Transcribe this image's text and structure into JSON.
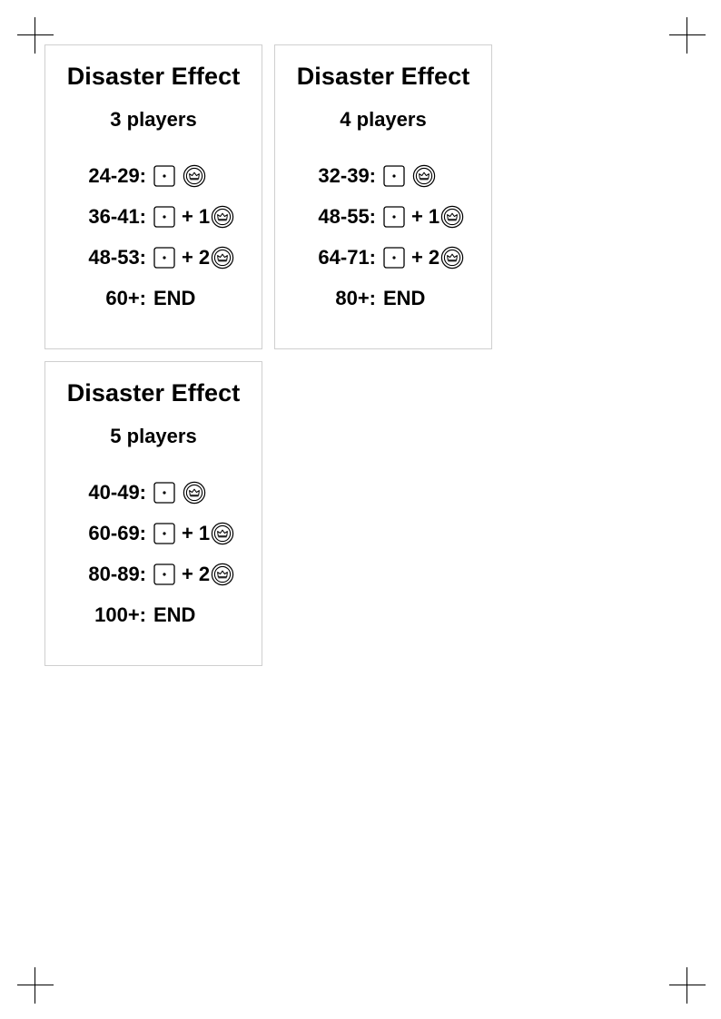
{
  "cards": [
    {
      "title": "Disaster Effect",
      "players": "3 players",
      "rows": [
        {
          "range": "24-29:",
          "plus": "",
          "count": ""
        },
        {
          "range": "36-41:",
          "plus": "+",
          "count": "1"
        },
        {
          "range": "48-53:",
          "plus": "+",
          "count": "2"
        }
      ],
      "end": {
        "range": "60+:",
        "text": "END"
      }
    },
    {
      "title": "Disaster Effect",
      "players": "4 players",
      "rows": [
        {
          "range": "32-39:",
          "plus": "",
          "count": ""
        },
        {
          "range": "48-55:",
          "plus": "+",
          "count": "1"
        },
        {
          "range": "64-71:",
          "plus": "+",
          "count": "2"
        }
      ],
      "end": {
        "range": "80+:",
        "text": "END"
      }
    },
    {
      "title": "Disaster Effect",
      "players": "5 players",
      "rows": [
        {
          "range": "40-49:",
          "plus": "",
          "count": ""
        },
        {
          "range": "60-69:",
          "plus": "+",
          "count": "1"
        },
        {
          "range": "80-89:",
          "plus": "+",
          "count": "2"
        }
      ],
      "end": {
        "range": "100+:",
        "text": "END"
      }
    }
  ],
  "icons": {
    "die": "die-icon",
    "crown": "crown-token-icon"
  }
}
